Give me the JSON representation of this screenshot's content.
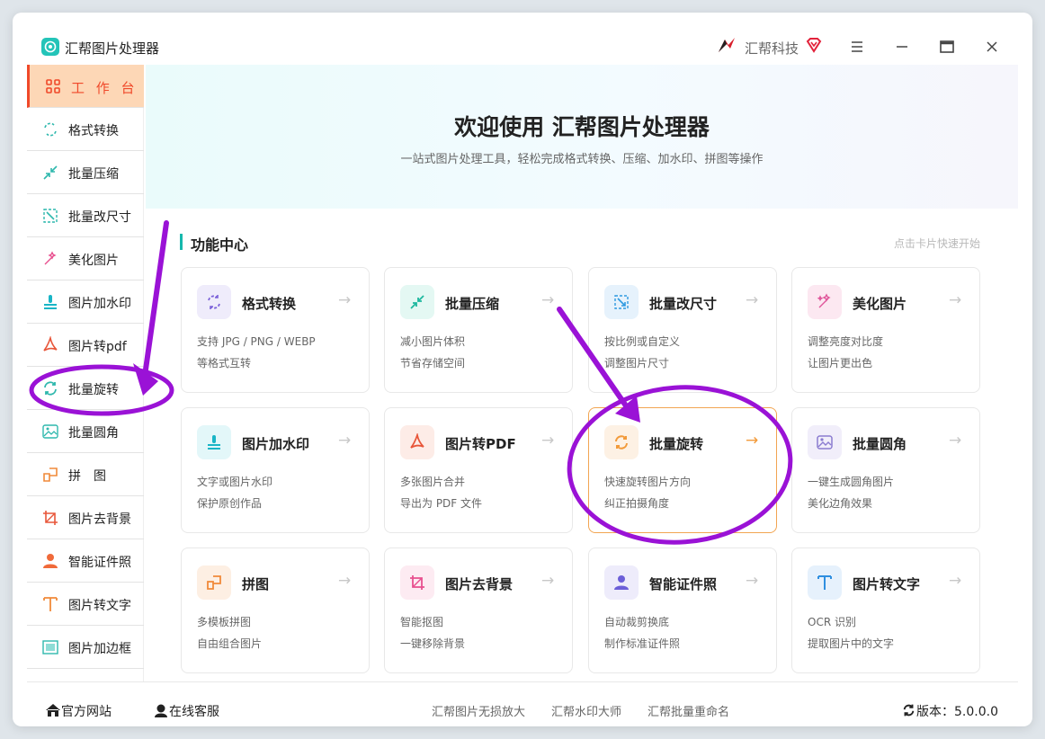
{
  "app": {
    "title": "汇帮图片处理器",
    "brand": "汇帮科技"
  },
  "sidebar": {
    "items": [
      {
        "label": "工 作 台",
        "icon": "grid-icon"
      },
      {
        "label": "格式转换",
        "icon": "convert-icon"
      },
      {
        "label": "批量压缩",
        "icon": "compress-icon"
      },
      {
        "label": "批量改尺寸",
        "icon": "resize-icon"
      },
      {
        "label": "美化图片",
        "icon": "beautify-icon"
      },
      {
        "label": "图片加水印",
        "icon": "watermark-icon"
      },
      {
        "label": "图片转pdf",
        "icon": "pdf-icon"
      },
      {
        "label": "批量旋转",
        "icon": "rotate-icon"
      },
      {
        "label": "批量圆角",
        "icon": "round-corner-icon"
      },
      {
        "label": "拼　图",
        "icon": "collage-icon"
      },
      {
        "label": "图片去背景",
        "icon": "crop-icon"
      },
      {
        "label": "智能证件照",
        "icon": "person-icon"
      },
      {
        "label": "图片转文字",
        "icon": "text-icon"
      },
      {
        "label": "图片加边框",
        "icon": "frame-icon"
      }
    ]
  },
  "banner": {
    "title": "欢迎使用 汇帮图片处理器",
    "subtitle": "一站式图片处理工具，轻松完成格式转换、压缩、加水印、拼图等操作"
  },
  "section": {
    "title": "功能中心",
    "hint": "点击卡片快速开始"
  },
  "cards": [
    {
      "title": "格式转换",
      "d1": "支持 JPG / PNG / WEBP",
      "d2": "等格式互转",
      "arrow": "→",
      "icon": "convert-icon",
      "color": "#7b61d9"
    },
    {
      "title": "批量压缩",
      "d1": "减小图片体积",
      "d2": "节省存储空间",
      "arrow": "→",
      "icon": "compress-icon",
      "color": "#1fb89f"
    },
    {
      "title": "批量改尺寸",
      "d1": "按比例或自定义",
      "d2": "调整图片尺寸",
      "arrow": "→",
      "icon": "resize-icon",
      "color": "#2f9ae0"
    },
    {
      "title": "美化图片",
      "d1": "调整亮度对比度",
      "d2": "让图片更出色",
      "arrow": "→",
      "icon": "beautify-icon",
      "color": "#e0559a"
    },
    {
      "title": "图片加水印",
      "d1": "文字或图片水印",
      "d2": "保护原创作品",
      "arrow": "→",
      "icon": "watermark-icon",
      "color": "#19b5c6"
    },
    {
      "title": "图片转PDF",
      "d1": "多张图片合并",
      "d2": "导出为 PDF 文件",
      "arrow": "→",
      "icon": "pdf-icon",
      "color": "#e8563a"
    },
    {
      "title": "批量旋转",
      "d1": "快速旋转图片方向",
      "d2": "纠正拍摄角度",
      "arrow": "→",
      "icon": "rotate-icon",
      "color": "#f29a3a"
    },
    {
      "title": "批量圆角",
      "d1": "一键生成圆角图片",
      "d2": "美化边角效果",
      "arrow": "→",
      "icon": "round-corner-icon",
      "color": "#8a7bd0"
    },
    {
      "title": "拼图",
      "d1": "多模板拼图",
      "d2": "自由组合图片",
      "arrow": "→",
      "icon": "collage-icon",
      "color": "#f08a3a"
    },
    {
      "title": "图片去背景",
      "d1": "智能抠图",
      "d2": "一键移除背景",
      "arrow": "→",
      "icon": "crop-icon",
      "color": "#e8508f"
    },
    {
      "title": "智能证件照",
      "d1": "自动裁剪换底",
      "d2": "制作标准证件照",
      "arrow": "→",
      "icon": "person-icon",
      "color": "#6c5fd8"
    },
    {
      "title": "图片转文字",
      "d1": "OCR 识别",
      "d2": "提取图片中的文字",
      "arrow": "→",
      "icon": "text-icon",
      "color": "#2f8fe0"
    }
  ],
  "footer": {
    "website": "官方网站",
    "support": "在线客服",
    "links": [
      "汇帮图片无损放大",
      "汇帮水印大师",
      "汇帮批量重命名"
    ],
    "version_label": "版本：5.0.0.0"
  },
  "colors": {
    "accent": "#f0492a",
    "active_bg": "#fdd7b6",
    "teal": "#16b8ad",
    "annotation": "#9a12d6"
  }
}
